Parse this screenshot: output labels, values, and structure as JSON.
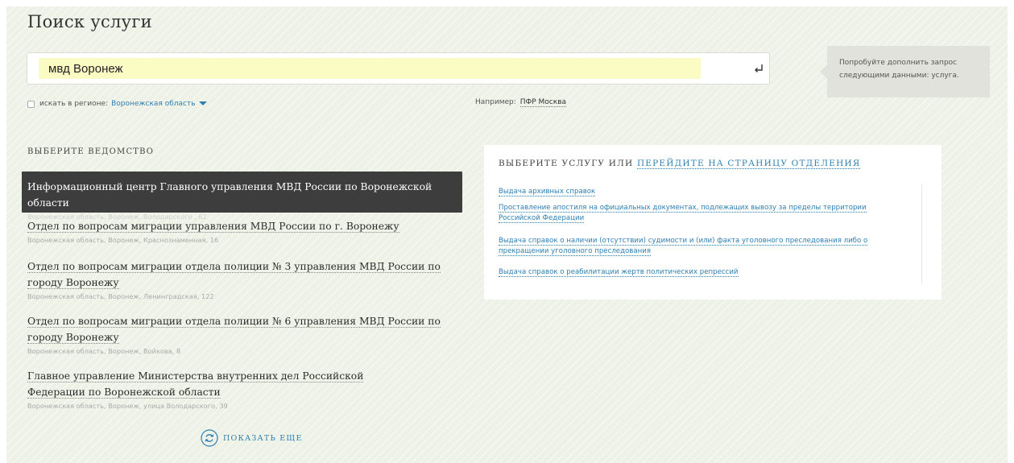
{
  "page_title": "Поиск услуги",
  "search": {
    "value": "мвд Воронеж",
    "enter_icon": "enter-return-icon"
  },
  "hint": {
    "text": "Попробуйте дополнить запрос следующими данными: услуга."
  },
  "region": {
    "checkbox_label": "искать в регионе:",
    "checked": false,
    "value": "Воронежская область"
  },
  "example": {
    "prefix": "Например:",
    "link": "ПФР Москва"
  },
  "departments": {
    "heading": "ВЫБЕРИТЕ ВЕДОМСТВО",
    "items": [
      {
        "name": "Информационный центр Главного управления МВД России по Воронежской области",
        "address": "Воронежская область, Воронеж, Володарского , 62",
        "selected": true
      },
      {
        "name": "Отдел по вопросам миграции управления МВД России по г. Воронежу",
        "address": "Воронежская область, Воронеж, Краснознаменная, 16",
        "selected": false
      },
      {
        "name": "Отдел по вопросам миграции отдела полиции № 3 управления МВД России по городу Воронежу",
        "address": "Воронежская область, Воронеж, Ленинградская, 122",
        "selected": false
      },
      {
        "name": "Отдел по вопросам миграции отдела полиции № 6 управления МВД России по городу Воронежу",
        "address": "Воронежская область, Воронеж, Войкова, 8",
        "selected": false
      },
      {
        "name": "Главное управление Министерства внутренних дел Российской Федерации по Воронежской области",
        "address": "Воронежская область, Воронеж, улица Володарского, 39",
        "selected": false
      }
    ],
    "show_more": "ПОКАЗАТЬ ЕЩЕ"
  },
  "services": {
    "heading_prefix": "ВЫБЕРИТЕ УСЛУГУ ИЛИ",
    "heading_link": "ПЕРЕЙДИТЕ НА СТРАНИЦУ ОТДЕЛЕНИЯ",
    "items": [
      "Выдача архивных справок",
      "Проставление апостиля на официальных документах, подлежащих вывозу за пределы территории Российской Федерации",
      "Выдача справок о наличии (отсутствии) судимости и (или) факта уголовного преследования либо о прекращении уголовного преследования",
      "Выдача справок о реабилитации жертв политических репрессий"
    ]
  },
  "colors": {
    "accent_link": "#2f7fb2",
    "selected_background": "#3d3d3d",
    "search_highlight": "#fbfbc4",
    "panel_background": "#eef2e6"
  }
}
